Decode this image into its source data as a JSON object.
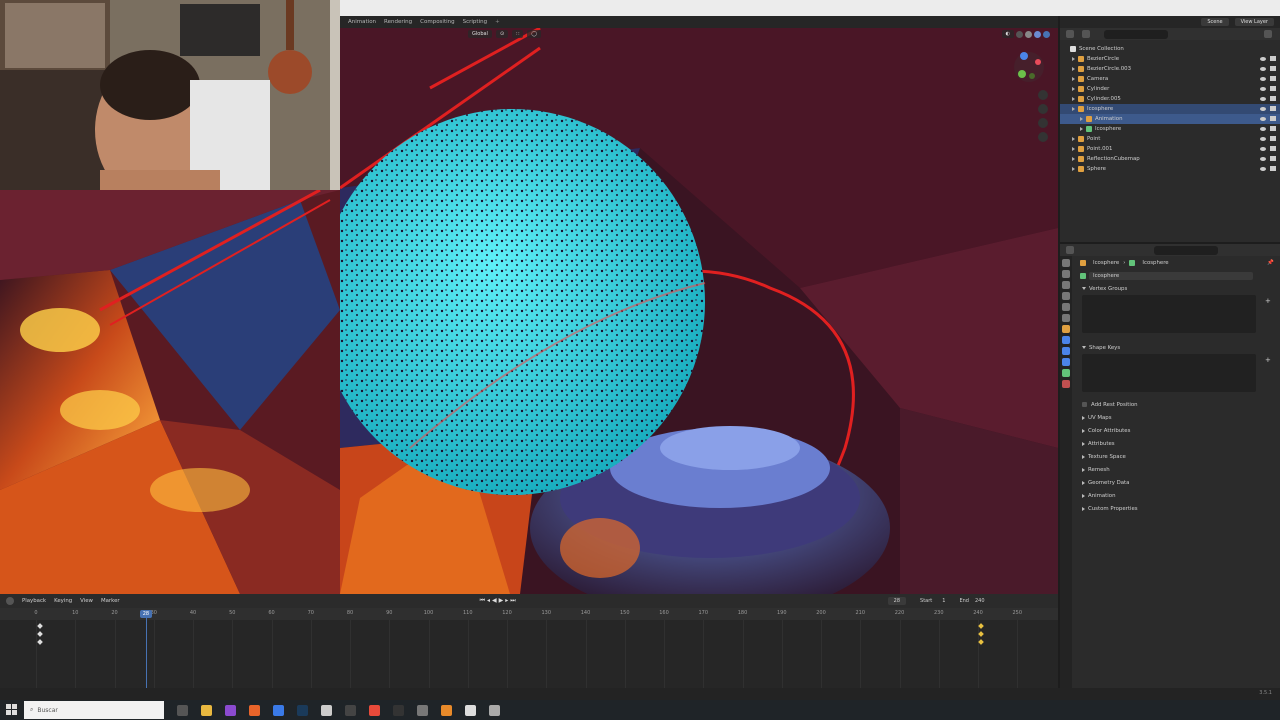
{
  "workspace_tabs": [
    "Animation",
    "Rendering",
    "Compositing",
    "Scripting",
    "+"
  ],
  "scene": {
    "label": "Scene",
    "view_layer": "View Layer"
  },
  "viewport": {
    "orientation": "Global"
  },
  "outliner": {
    "search_placeholder": "",
    "root": "Scene Collection",
    "items": [
      {
        "label": "BezierCircle",
        "icon_color": "#e0a040",
        "indent": 1
      },
      {
        "label": "BezierCircle.003",
        "icon_color": "#e0a040",
        "indent": 1
      },
      {
        "label": "Camera",
        "icon_color": "#e0a040",
        "indent": 1
      },
      {
        "label": "Cylinder",
        "icon_color": "#e0a040",
        "indent": 1
      },
      {
        "label": "Cylinder.005",
        "icon_color": "#e0a040",
        "indent": 1
      },
      {
        "label": "Icosphere",
        "icon_color": "#e0a040",
        "indent": 1,
        "selected": true
      },
      {
        "label": "Animation",
        "icon_color": "#e0a040",
        "indent": 2,
        "active": true
      },
      {
        "label": "Icosphere",
        "icon_color": "#62c37a",
        "indent": 2
      },
      {
        "label": "Point",
        "icon_color": "#e0a040",
        "indent": 1
      },
      {
        "label": "Point.001",
        "icon_color": "#e0a040",
        "indent": 1
      },
      {
        "label": "ReflectionCubemap",
        "icon_color": "#e0a040",
        "indent": 1
      },
      {
        "label": "Sphere",
        "icon_color": "#e0a040",
        "indent": 1
      }
    ]
  },
  "properties": {
    "breadcrumb_object": "Icosphere",
    "breadcrumb_mesh": "Icosphere",
    "mesh_name": "Icosphere",
    "sections": {
      "vertex_groups": "Vertex Groups",
      "shape_keys": "Shape Keys",
      "add_rest_position": "Add Rest Position",
      "collapsed": [
        "UV Maps",
        "Color Attributes",
        "Attributes",
        "Texture Space",
        "Remesh",
        "Geometry Data",
        "Animation",
        "Custom Properties"
      ]
    }
  },
  "timeline": {
    "menus": [
      "Playback",
      "Keying",
      "View",
      "Marker"
    ],
    "current_frame": "28",
    "start_label": "Start",
    "start": "1",
    "end_label": "End",
    "end": "240",
    "current_frame_value": 28,
    "ticks": [
      0,
      10,
      20,
      30,
      40,
      50,
      60,
      70,
      80,
      90,
      100,
      110,
      120,
      130,
      140,
      150,
      160,
      170,
      180,
      190,
      200,
      210,
      220,
      230,
      240,
      250
    ]
  },
  "status": {
    "version": "3.5.1"
  },
  "taskbar": {
    "search_placeholder": "Buscar"
  },
  "colors": {
    "accent": "#4772b3",
    "panel": "#2b2b2b",
    "sphere": "#37d9e6",
    "curve": "#e02020"
  }
}
